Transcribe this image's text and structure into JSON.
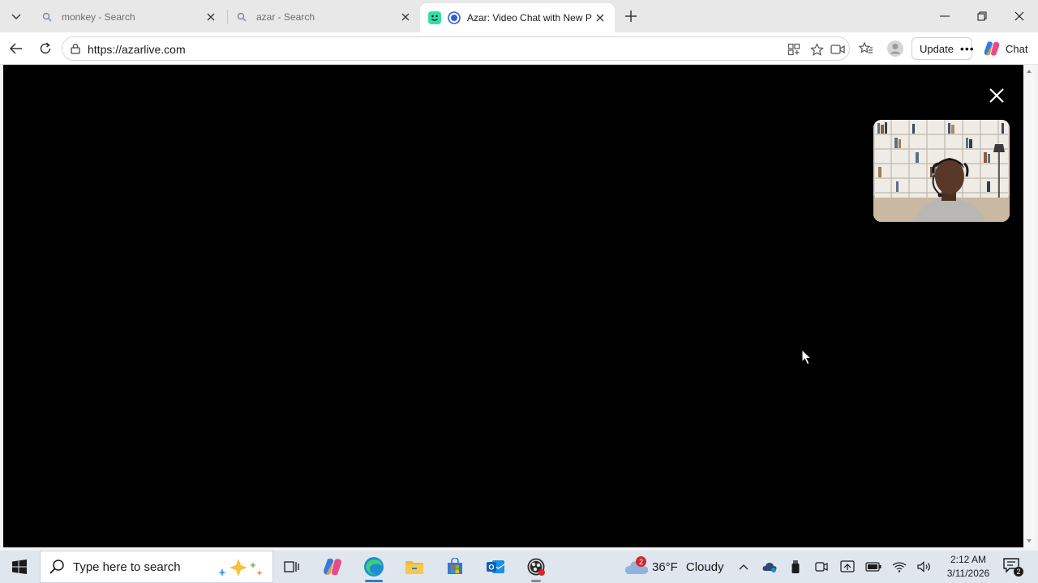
{
  "browser": {
    "tabs": [
      {
        "title": "monkey - Search",
        "favicon": "search-icon",
        "active": false
      },
      {
        "title": "azar - Search",
        "favicon": "search-icon",
        "active": false
      },
      {
        "title": "Azar: Video Chat with New Pe",
        "favicon": "azar-logo",
        "active": true
      }
    ],
    "url": "https://azarlive.com",
    "update_label": "Update",
    "chat_label": "Chat"
  },
  "page": {
    "background": "#000000",
    "self_view": "webcam-preview"
  },
  "taskbar": {
    "search_placeholder": "Type here to search",
    "apps": [
      "task-view-icon",
      "copilot-icon",
      "edge-icon",
      "file-explorer-icon",
      "store-icon",
      "outlook-icon",
      "obs-icon"
    ],
    "weather": {
      "badge": "2",
      "temp": "36°F",
      "condition": "Cloudy"
    },
    "time": "2:12 AM",
    "date": "3/11/2026",
    "notifications": "2"
  }
}
